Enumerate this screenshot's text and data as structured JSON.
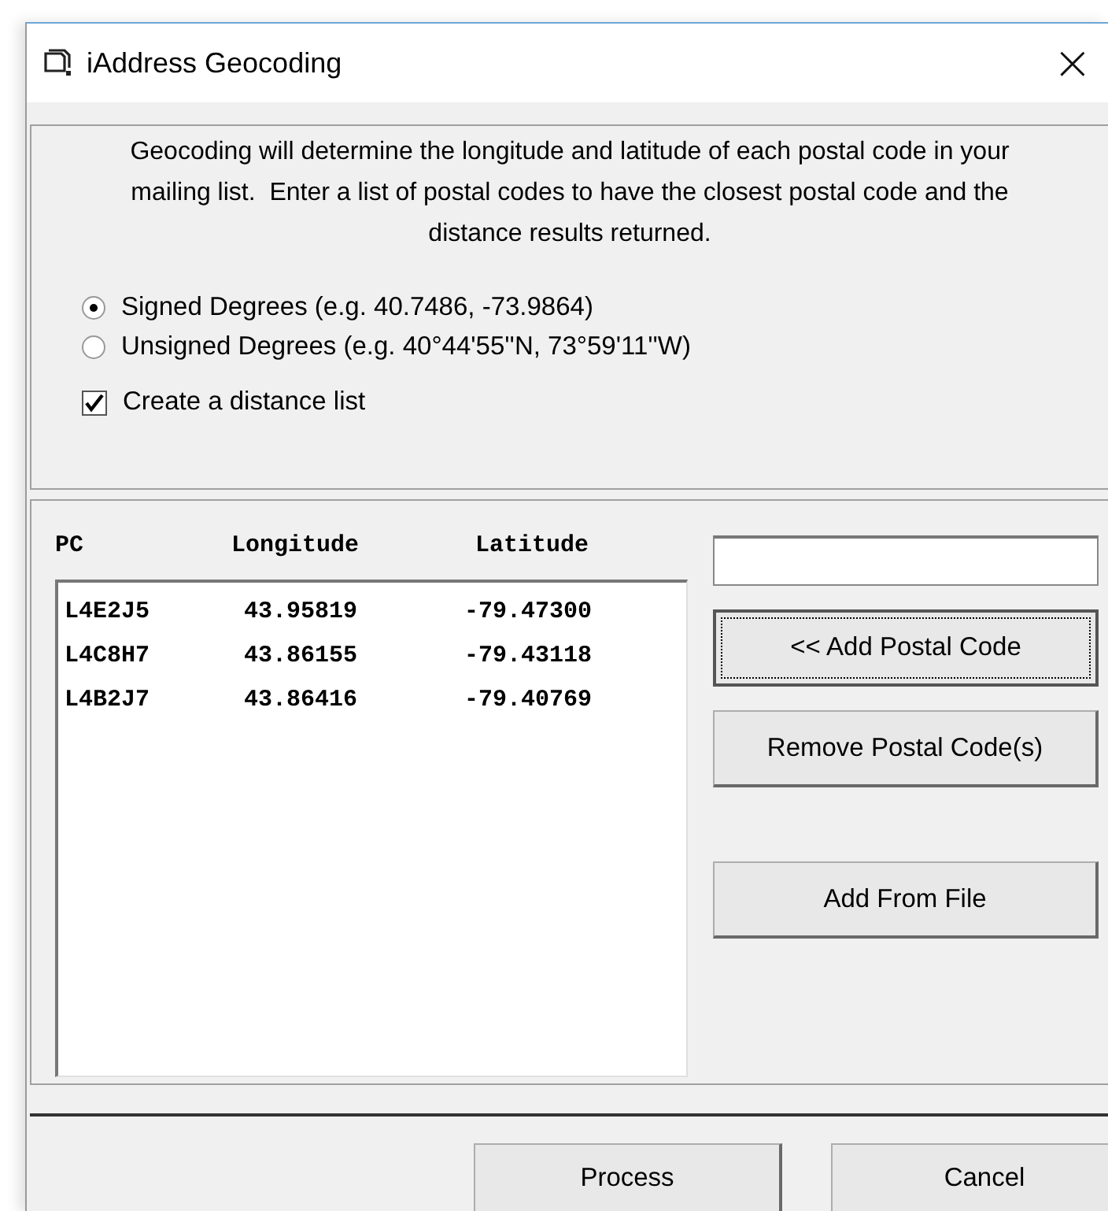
{
  "window": {
    "title": "iAddress Geocoding",
    "close": "×"
  },
  "description": "Geocoding will determine the longitude and latitude of each postal code in your mailing list.  Enter a list of postal codes to have the closest postal code and the distance results returned.",
  "format_options": [
    {
      "label": "Signed Degrees (e.g. 40.7486, -73.9864)",
      "selected": true
    },
    {
      "label": "Unsigned Degrees (e.g. 40°44'55''N, 73°59'11''W)",
      "selected": false
    }
  ],
  "distance_list": {
    "label": "Create a distance list",
    "checked": true
  },
  "list": {
    "columns": [
      "PC",
      "Longitude",
      "Latitude"
    ],
    "rows": [
      [
        "L4E2J5",
        "43.95819",
        "-79.47300"
      ],
      [
        "L4C8H7",
        "43.86155",
        "-79.43118"
      ],
      [
        "L4B2J7",
        "43.86416",
        "-79.40769"
      ]
    ]
  },
  "side_buttons": [
    {
      "label": "<< Add Postal Code",
      "focused": true
    },
    {
      "label": "Remove Postal Code(s)",
      "focused": false
    },
    {
      "label": "Add From File",
      "focused": false
    }
  ],
  "footer_buttons": [
    "Process",
    "Cancel"
  ]
}
